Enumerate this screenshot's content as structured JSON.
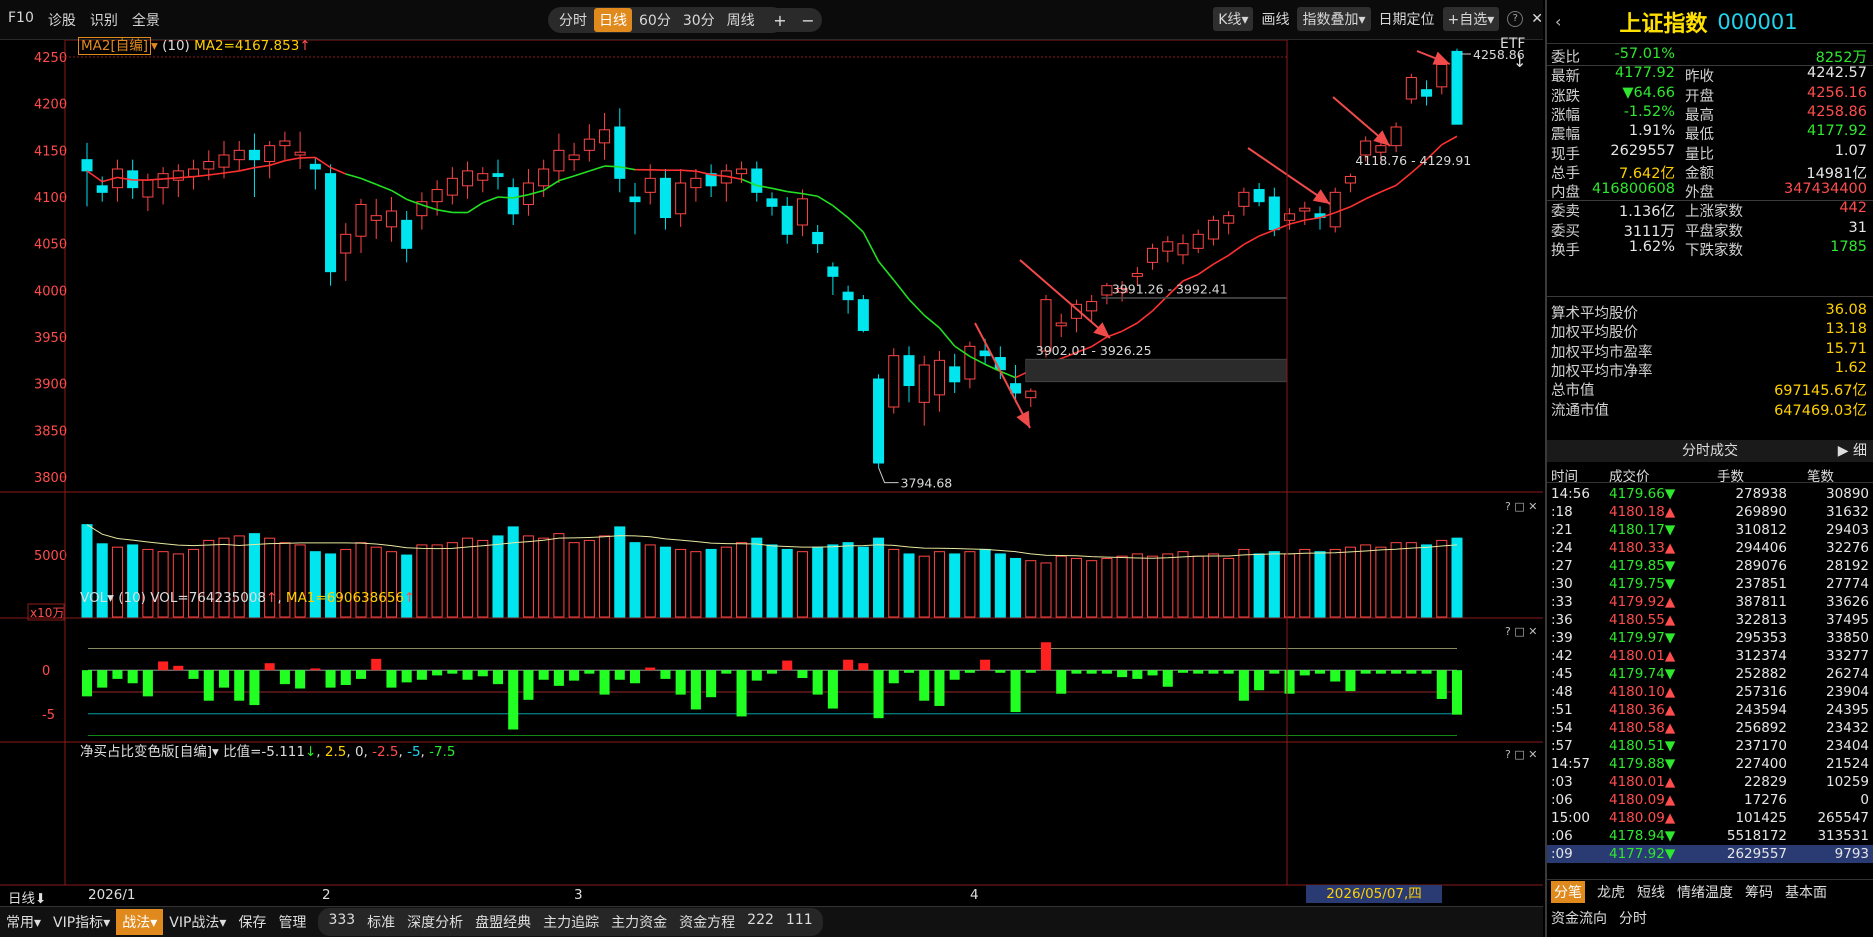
{
  "toolbar": {
    "left": [
      "F10",
      "诊股",
      "识别",
      "全景"
    ],
    "periods": [
      "分时",
      "日线",
      "60分",
      "30分",
      "周线"
    ],
    "active_period": "日线",
    "zoom": [
      "+",
      "−"
    ],
    "right": [
      "K线",
      "画线",
      "指数叠加",
      "日期定位",
      "+自选"
    ],
    "etf": "ETF"
  },
  "main_chart": {
    "indicator_label": "MA2[自编]",
    "indicator_param": "(10)",
    "indicator_value": "MA2=4167.853",
    "y_ticks": [
      "4250",
      "4200",
      "4150",
      "4100",
      "4050",
      "4000",
      "3950",
      "3900",
      "3850",
      "3800"
    ],
    "annotations": {
      "high": "4258.86",
      "low": "3794.68",
      "gap1": "3902.01 - 3926.25",
      "gap2": "3991.26 - 3992.41",
      "gap3": "4118.76 - 4129.91"
    }
  },
  "vol_chart": {
    "label": "VOL",
    "param": "(10)",
    "value": "VOL=764235008",
    "ma": "MA1=690638656",
    "y_tick": "5000",
    "unit": "x10万"
  },
  "ratio_chart": {
    "label": "净买占比变色版[自编]",
    "value": "比值=-5.111",
    "levels": [
      "2.5",
      "0",
      "-2.5",
      "-5",
      "-7.5"
    ],
    "y_ticks": [
      "0",
      "-5"
    ]
  },
  "x_axis": {
    "period_label": "日线",
    "ticks": [
      "2026/1",
      "2",
      "3",
      "4"
    ],
    "cursor_date": "2026/05/07,四"
  },
  "bottombar": {
    "items": [
      "常用",
      "VIP指标",
      "战法",
      "VIP战法",
      "保存",
      "管理",
      "333",
      "标准",
      "深度分析",
      "盘盟经典",
      "主力追踪",
      "主力资金",
      "资金方程",
      "222",
      "111"
    ],
    "active": "战法"
  },
  "quote": {
    "name": "上证指数",
    "code": "000001",
    "rows": [
      {
        "l1": "委比",
        "v1": "-57.01%",
        "c1": "green",
        "l2": "",
        "v2": "8252万",
        "c2": "green"
      },
      {
        "l1": "最新",
        "v1": "4177.92",
        "c1": "green",
        "l2": "昨收",
        "v2": "4242.57",
        "c2": "white"
      },
      {
        "l1": "涨跌",
        "v1": "▼64.66",
        "c1": "green",
        "l2": "开盘",
        "v2": "4256.16",
        "c2": "red"
      },
      {
        "l1": "涨幅",
        "v1": "-1.52%",
        "c1": "green",
        "l2": "最高",
        "v2": "4258.86",
        "c2": "red"
      },
      {
        "l1": "震幅",
        "v1": "1.91%",
        "c1": "white",
        "l2": "最低",
        "v2": "4177.92",
        "c2": "green"
      },
      {
        "l1": "现手",
        "v1": "2629557",
        "c1": "white",
        "l2": "量比",
        "v2": "1.07",
        "c2": "white"
      },
      {
        "l1": "总手",
        "v1": "7.642亿",
        "c1": "yel",
        "l2": "金额",
        "v2": "14981亿",
        "c2": "white"
      },
      {
        "l1": "内盘",
        "v1": "416800608",
        "c1": "green",
        "l2": "外盘",
        "v2": "347434400",
        "c2": "red"
      },
      {
        "l1": "委卖",
        "v1": "1.136亿",
        "c1": "white",
        "l2": "上涨家数",
        "v2": "442",
        "c2": "red"
      },
      {
        "l1": "委买",
        "v1": "3111万",
        "c1": "white",
        "l2": "平盘家数",
        "v2": "31",
        "c2": "white"
      },
      {
        "l1": "换手",
        "v1": "1.62%",
        "c1": "white",
        "l2": "下跌家数",
        "v2": "1785",
        "c2": "green"
      }
    ],
    "stats": [
      {
        "l": "算术平均股价",
        "v": "36.08"
      },
      {
        "l": "加权平均股价",
        "v": "13.18"
      },
      {
        "l": "加权平均市盈率",
        "v": "15.71"
      },
      {
        "l": "加权平均市净率",
        "v": "1.62"
      },
      {
        "l": "总市值",
        "v": "697145.67亿"
      },
      {
        "l": "流通市值",
        "v": "647469.03亿"
      }
    ]
  },
  "trades": {
    "title": "分时成交",
    "toggle": "细",
    "columns": [
      "时间",
      "成交价",
      "手数",
      "笔数"
    ],
    "rows": [
      {
        "t": "14:56",
        "p": "4179.66",
        "d": "▼",
        "c": "green",
        "v": "278938",
        "n": "30890"
      },
      {
        "t": ":18",
        "p": "4180.18",
        "d": "▲",
        "c": "red",
        "v": "269890",
        "n": "31632"
      },
      {
        "t": ":21",
        "p": "4180.17",
        "d": "▼",
        "c": "green",
        "v": "310812",
        "n": "29403"
      },
      {
        "t": ":24",
        "p": "4180.33",
        "d": "▲",
        "c": "red",
        "v": "294406",
        "n": "32276"
      },
      {
        "t": ":27",
        "p": "4179.85",
        "d": "▼",
        "c": "green",
        "v": "289076",
        "n": "28192"
      },
      {
        "t": ":30",
        "p": "4179.75",
        "d": "▼",
        "c": "green",
        "v": "237851",
        "n": "27774"
      },
      {
        "t": ":33",
        "p": "4179.92",
        "d": "▲",
        "c": "red",
        "v": "387811",
        "n": "33626"
      },
      {
        "t": ":36",
        "p": "4180.55",
        "d": "▲",
        "c": "red",
        "v": "322813",
        "n": "37495"
      },
      {
        "t": ":39",
        "p": "4179.97",
        "d": "▼",
        "c": "green",
        "v": "295353",
        "n": "33850"
      },
      {
        "t": ":42",
        "p": "4180.01",
        "d": "▲",
        "c": "red",
        "v": "312374",
        "n": "33277"
      },
      {
        "t": ":45",
        "p": "4179.74",
        "d": "▼",
        "c": "green",
        "v": "252882",
        "n": "26274"
      },
      {
        "t": ":48",
        "p": "4180.10",
        "d": "▲",
        "c": "red",
        "v": "257316",
        "n": "23904"
      },
      {
        "t": ":51",
        "p": "4180.36",
        "d": "▲",
        "c": "red",
        "v": "243594",
        "n": "24395"
      },
      {
        "t": ":54",
        "p": "4180.58",
        "d": "▲",
        "c": "red",
        "v": "256892",
        "n": "23432"
      },
      {
        "t": ":57",
        "p": "4180.51",
        "d": "▼",
        "c": "green",
        "v": "237170",
        "n": "23404"
      },
      {
        "t": "14:57",
        "p": "4179.88",
        "d": "▼",
        "c": "green",
        "v": "227400",
        "n": "21524"
      },
      {
        "t": ":03",
        "p": "4180.01",
        "d": "▲",
        "c": "red",
        "v": "22829",
        "n": "10259"
      },
      {
        "t": ":06",
        "p": "4180.09",
        "d": "▲",
        "c": "red",
        "v": "17276",
        "n": "0"
      },
      {
        "t": "15:00",
        "p": "4180.09",
        "d": "▲",
        "c": "red",
        "v": "101425",
        "n": "265547"
      },
      {
        "t": ":06",
        "p": "4178.94",
        "d": "▼",
        "c": "green",
        "v": "5518172",
        "n": "313531"
      },
      {
        "t": ":09",
        "p": "4177.92",
        "d": "▼",
        "c": "green",
        "v": "2629557",
        "n": "9793"
      }
    ]
  },
  "tabs1": [
    "分笔",
    "龙虎",
    "短线",
    "情绪温度",
    "筹码",
    "基本面"
  ],
  "tabs1_active": "分笔",
  "tabs2": [
    "资金流向",
    "分时"
  ],
  "chart_data": {
    "type": "candlestick",
    "ylim": [
      3780,
      4265
    ],
    "candles": [
      [
        4140,
        4158,
        4090,
        4128
      ],
      [
        4112,
        4122,
        4095,
        4105
      ],
      [
        4110,
        4140,
        4095,
        4130
      ],
      [
        4128,
        4140,
        4098,
        4110
      ],
      [
        4100,
        4125,
        4085,
        4118
      ],
      [
        4110,
        4132,
        4092,
        4125
      ],
      [
        4118,
        4135,
        4100,
        4128
      ],
      [
        4122,
        4140,
        4108,
        4130
      ],
      [
        4130,
        4150,
        4118,
        4138
      ],
      [
        4132,
        4160,
        4120,
        4145
      ],
      [
        4140,
        4160,
        4128,
        4150
      ],
      [
        4150,
        4168,
        4100,
        4140
      ],
      [
        4138,
        4160,
        4120,
        4155
      ],
      [
        4155,
        4170,
        4140,
        4160
      ],
      [
        4145,
        4170,
        4130,
        4148
      ],
      [
        4135,
        4142,
        4108,
        4130
      ],
      [
        4125,
        4135,
        4005,
        4020
      ],
      [
        4040,
        4072,
        4010,
        4060
      ],
      [
        4058,
        4098,
        4040,
        4092
      ],
      [
        4075,
        4098,
        4055,
        4080
      ],
      [
        4068,
        4100,
        4052,
        4085
      ],
      [
        4075,
        4085,
        4030,
        4045
      ],
      [
        4080,
        4105,
        4065,
        4095
      ],
      [
        4095,
        4118,
        4080,
        4108
      ],
      [
        4102,
        4132,
        4092,
        4120
      ],
      [
        4112,
        4138,
        4098,
        4128
      ],
      [
        4118,
        4132,
        4105,
        4125
      ],
      [
        4125,
        4140,
        4108,
        4122
      ],
      [
        4110,
        4120,
        4070,
        4082
      ],
      [
        4092,
        4130,
        4080,
        4115
      ],
      [
        4112,
        4140,
        4100,
        4130
      ],
      [
        4128,
        4168,
        4115,
        4150
      ],
      [
        4140,
        4158,
        4128,
        4145
      ],
      [
        4150,
        4178,
        4138,
        4162
      ],
      [
        4158,
        4190,
        4140,
        4172
      ],
      [
        4175,
        4195,
        4105,
        4120
      ],
      [
        4100,
        4115,
        4060,
        4095
      ],
      [
        4105,
        4135,
        4092,
        4120
      ],
      [
        4120,
        4130,
        4065,
        4078
      ],
      [
        4082,
        4130,
        4068,
        4115
      ],
      [
        4110,
        4130,
        4095,
        4120
      ],
      [
        4125,
        4135,
        4100,
        4112
      ],
      [
        4115,
        4135,
        4095,
        4128
      ],
      [
        4125,
        4138,
        4115,
        4130
      ],
      [
        4130,
        4138,
        4095,
        4105
      ],
      [
        4098,
        4105,
        4080,
        4090
      ],
      [
        4090,
        4100,
        4050,
        4060
      ],
      [
        4070,
        4108,
        4058,
        4098
      ],
      [
        4062,
        4070,
        4040,
        4050
      ],
      [
        4025,
        4030,
        3995,
        4015
      ],
      [
        3998,
        4005,
        3975,
        3990
      ],
      [
        3990,
        3995,
        3955,
        3957
      ],
      [
        3905,
        3910,
        3810,
        3815
      ],
      [
        3875,
        3938,
        3868,
        3930
      ],
      [
        3930,
        3940,
        3880,
        3898
      ],
      [
        3880,
        3930,
        3855,
        3920
      ],
      [
        3888,
        3935,
        3870,
        3925
      ],
      [
        3918,
        3932,
        3890,
        3902
      ],
      [
        3905,
        3945,
        3895,
        3940
      ],
      [
        3935,
        3948,
        3920,
        3930
      ],
      [
        3928,
        3940,
        3905,
        3915
      ],
      [
        3900,
        3920,
        3880,
        3890
      ],
      [
        3885,
        3895,
        3875,
        3892
      ],
      [
        3935,
        3995,
        3928,
        3990
      ],
      [
        3962,
        3975,
        3950,
        3965
      ],
      [
        3970,
        3990,
        3955,
        3985
      ],
      [
        3978,
        3995,
        3965,
        3988
      ],
      [
        3995,
        4008,
        3985,
        4005
      ],
      [
        3998,
        4010,
        3988,
        4002
      ],
      [
        4015,
        4025,
        4005,
        4018
      ],
      [
        4030,
        4050,
        4022,
        4045
      ],
      [
        4042,
        4058,
        4030,
        4052
      ],
      [
        4038,
        4060,
        4028,
        4050
      ],
      [
        4045,
        4065,
        4040,
        4060
      ],
      [
        4055,
        4080,
        4048,
        4075
      ],
      [
        4072,
        4085,
        4060,
        4080
      ],
      [
        4090,
        4110,
        4080,
        4105
      ],
      [
        4108,
        4115,
        4090,
        4095
      ],
      [
        4100,
        4110,
        4058,
        4065
      ],
      [
        4075,
        4088,
        4065,
        4082
      ],
      [
        4085,
        4095,
        4070,
        4088
      ],
      [
        4082,
        4090,
        4065,
        4078
      ],
      [
        4068,
        4110,
        4062,
        4105
      ],
      [
        4115,
        4125,
        4105,
        4122
      ],
      [
        4145,
        4165,
        4138,
        4160
      ],
      [
        4148,
        4165,
        4138,
        4155
      ],
      [
        4155,
        4180,
        4148,
        4175
      ],
      [
        4205,
        4232,
        4200,
        4228
      ],
      [
        4215,
        4225,
        4198,
        4208
      ],
      [
        4218,
        4245,
        4210,
        4242
      ],
      [
        4256,
        4259,
        4178,
        4178
      ]
    ],
    "vol": [
      82,
      65,
      62,
      64,
      60,
      58,
      56,
      60,
      68,
      70,
      72,
      74,
      70,
      66,
      64,
      58,
      56,
      60,
      66,
      62,
      58,
      55,
      64,
      64,
      66,
      70,
      68,
      72,
      80,
      72,
      70,
      74,
      66,
      68,
      72,
      80,
      66,
      64,
      62,
      60,
      58,
      60,
      62,
      66,
      70,
      64,
      60,
      58,
      62,
      64,
      66,
      62,
      70,
      60,
      56,
      54,
      58,
      56,
      58,
      60,
      56,
      52,
      50,
      48,
      54,
      52,
      50,
      52,
      54,
      56,
      54,
      56,
      58,
      54,
      56,
      52,
      60,
      56,
      58,
      56,
      60,
      58,
      60,
      62,
      64,
      62,
      66,
      66,
      64,
      68,
      70
    ],
    "ratio": [
      -3,
      -2,
      -1,
      -1.5,
      -3,
      1,
      0.5,
      -1,
      -3.5,
      -2,
      -3.5,
      -4,
      0.8,
      -1.6,
      -2.1,
      0.2,
      -2,
      -1.7,
      -1,
      1.3,
      -2,
      -1.4,
      -1.1,
      -0.6,
      -0.4,
      -1.1,
      -0.7,
      -1.6,
      -6.8,
      -3.4,
      -1.1,
      -1.8,
      -1.2,
      -0.4,
      -2.8,
      -1.1,
      -1.5,
      0.3,
      -1,
      -2.8,
      -4.5,
      -3.1,
      -0.4,
      -5.3,
      -1.2,
      -0.4,
      1.1,
      -0.9,
      -2.8,
      -4.4,
      1.2,
      0.8,
      -5.5,
      -1.5,
      -0.3,
      -3.5,
      -4.1,
      -1.1,
      -0.3,
      1.2,
      -0.3,
      -4.8,
      -0.3,
      3.2,
      -2.7,
      -0.4,
      -0.4,
      -0.4,
      -0.8,
      -1,
      -0.6,
      -1.9,
      -0.3,
      -0.4,
      -0.4,
      -0.4,
      -3.5,
      -2.3,
      -0.4,
      -2.7,
      -0.6,
      -0.4,
      -1.3,
      -2.4,
      -0.4,
      -0.4,
      -0.4,
      -0.4,
      -0.4,
      -3.3,
      -5.1
    ],
    "series": [
      {
        "name": "MA2",
        "color": "#ff3030"
      },
      {
        "name": "VOL",
        "color": "#00e5ee"
      }
    ]
  }
}
